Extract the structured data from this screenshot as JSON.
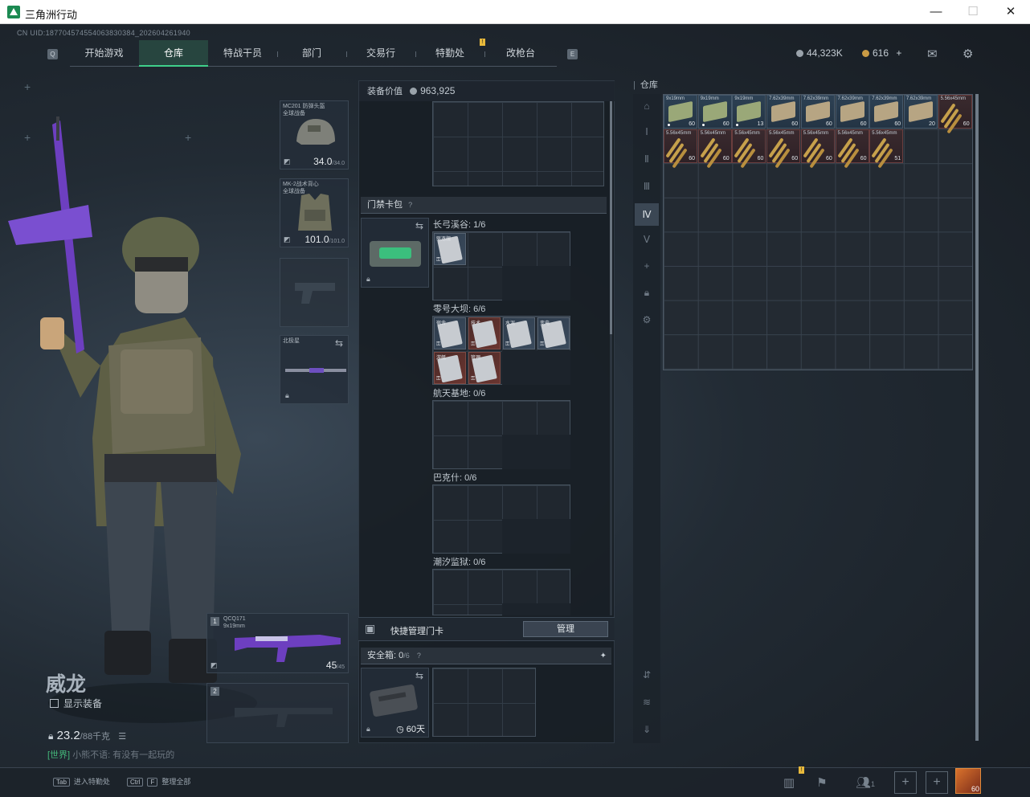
{
  "window": {
    "title": "三角洲行动",
    "min": "—",
    "max": "☐",
    "close": "✕"
  },
  "uid": "CN UID:187704574554063830384_202604261940",
  "nav": {
    "left_key": "Q",
    "right_key": "E",
    "tabs": [
      "开始游戏",
      "仓库",
      "特战干员",
      "部门",
      "交易行",
      "特勤处",
      "改枪台"
    ],
    "active": "仓库",
    "notice_badge": "!"
  },
  "currency": {
    "coins": "44,323K",
    "tickets": "616",
    "add": "+"
  },
  "operator": {
    "name": "威龙",
    "show_equipment": "显示装备",
    "weight": "23.2",
    "weight_max": "/88千克",
    "chat_channel": "[世界]",
    "chat_text": "小熊不语: 有没有一起玩的"
  },
  "gear": {
    "helmet": {
      "name": "MC201 防弹头盔",
      "sub": "全球战备",
      "durability": "34.0",
      "max": "/34.0"
    },
    "armor": {
      "name": "MK-2战术背心",
      "sub": "全球战备",
      "durability": "101.0",
      "max": "/101.0"
    },
    "melee": {
      "name": "北极星"
    },
    "primary": {
      "index": "1",
      "name": "QCQ171",
      "ammo_type": "9x19mm",
      "ammo": "45",
      "ammo_max": "/45"
    },
    "secondary": {
      "index": "2"
    }
  },
  "middle": {
    "equip_value_label": "装备价值",
    "equip_value": "963,925",
    "keycard_pack": "门禁卡包",
    "help": "?",
    "zones": [
      {
        "name": "长弓溪谷: 1/6"
      },
      {
        "name": "零号大坝: 6/6"
      },
      {
        "name": "航天基地: 0/6"
      },
      {
        "name": "巴克什: 0/6"
      },
      {
        "name": "潮汐监狱: 0/6"
      }
    ],
    "cards_dam": [
      "宿舍",
      "技术",
      "水泥",
      "变电",
      "游艇",
      "管理"
    ],
    "card_longbow": "驱逐舰",
    "quick_manage": "快捷管理门卡",
    "manage_button": "管理",
    "safe_box": "安全箱: 0",
    "safe_box_max": "/6",
    "safe_box_days": "60天",
    "pin": "⚲"
  },
  "storage": {
    "title": "仓库",
    "ammo": [
      {
        "name": "9x19mm",
        "qty": "60",
        "kind": "green"
      },
      {
        "name": "9x19mm",
        "qty": "60",
        "kind": "green"
      },
      {
        "name": "9x19mm",
        "qty": "13",
        "kind": "green"
      },
      {
        "name": "7.62x39mm",
        "qty": "60",
        "kind": "tan"
      },
      {
        "name": "7.62x39mm",
        "qty": "60",
        "kind": "tan"
      },
      {
        "name": "7.62x39mm",
        "qty": "60",
        "kind": "tan"
      },
      {
        "name": "7.62x39mm",
        "qty": "60",
        "kind": "tan"
      },
      {
        "name": "7.62x39mm",
        "qty": "20",
        "kind": "tan"
      },
      {
        "name": "5.56x45mm",
        "qty": "60",
        "kind": "red"
      },
      {
        "name": "5.56x45mm",
        "qty": "60",
        "kind": "red"
      },
      {
        "name": "5.56x45mm",
        "qty": "60",
        "kind": "red"
      },
      {
        "name": "5.56x45mm",
        "qty": "60",
        "kind": "red"
      },
      {
        "name": "5.56x45mm",
        "qty": "60",
        "kind": "red"
      },
      {
        "name": "5.56x45mm",
        "qty": "60",
        "kind": "red"
      },
      {
        "name": "5.56x45mm",
        "qty": "60",
        "kind": "red"
      },
      {
        "name": "5.56x45mm",
        "qty": "51",
        "kind": "red"
      }
    ]
  },
  "bottom": {
    "hint1_key": "Tab",
    "hint1": "进入特勤处",
    "hint2_key1": "Ctrl",
    "hint2_key2": "F",
    "hint2": "整理全部",
    "friends": "1",
    "level": "60"
  }
}
